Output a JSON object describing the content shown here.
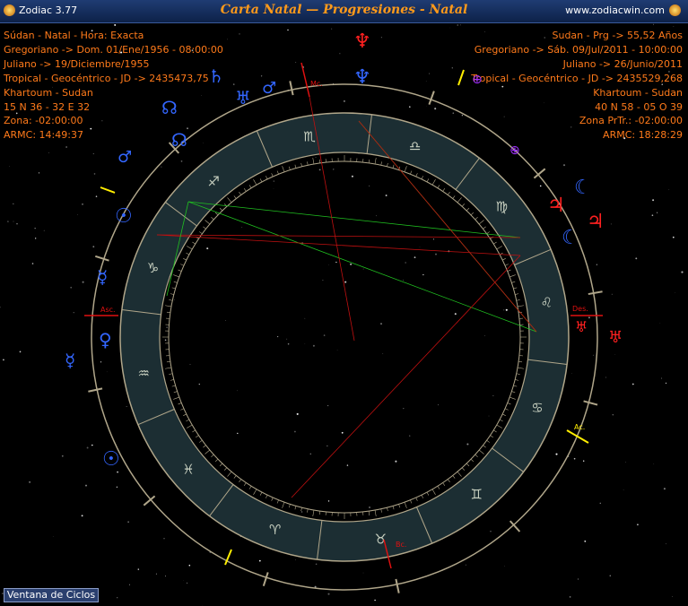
{
  "app": {
    "name": "Zodiac 3.77",
    "title": "Carta Natal — Progresiones - Natal",
    "url": "www.zodiacwin.com"
  },
  "left_info": [
    "Súdan - Natal - Hora: Exacta",
    "Gregoriano -> Dom. 01/Ene/1956 - 08:00:00",
    "Juliano -> 19/Diciembre/1955",
    "Tropical - Geocéntrico - JD -> 2435473,75",
    "Khartoum - Sudan",
    "15 N 36 - 32 E 32",
    "Zona: -02:00:00",
    "ARMC: 14:49:37"
  ],
  "right_info": [
    "Sudan - Prg -> 55,52 Años",
    "Gregoriano -> Sáb. 09/Jul/2011 - 10:00:00",
    "Juliano -> 26/Junio/2011",
    "Tropical - Geocéntrico - JD -> 2435529,268",
    "Khartoum - Sudan",
    "40 N 58 - 05 O 39",
    "Zona PrTr.: -02:00:00",
    "ARMC: 18:28:29"
  ],
  "chart": {
    "axis_labels": {
      "mc": "Mc.",
      "asc": "Asc.",
      "des": "Des.",
      "bc": "Bc.",
      "asc_outer": "Ac."
    },
    "zodiac_signs": [
      "♈",
      "♉",
      "♊",
      "♋",
      "♌",
      "♍",
      "♎",
      "♏",
      "♐",
      "♑",
      "♒",
      "♓"
    ],
    "outer_planets": {
      "neptune": "♆",
      "uranus": "♅",
      "saturn": "♄",
      "mars": "♂",
      "node": "☊",
      "sun": "☉",
      "mercury": "☿",
      "venus": "♀",
      "pluto_like": "⊕",
      "moon": "☾",
      "jupiter": "♃"
    },
    "colors": {
      "accent": "#ff9a1a",
      "info_text": "#ff7a1a",
      "ring": "#1c2e33",
      "ring_line": "#b0a68a",
      "planet_blue": "#3366ff",
      "planet_red": "#ff2020"
    }
  },
  "footer": {
    "cycles_button": "Ventana de Ciclos"
  }
}
